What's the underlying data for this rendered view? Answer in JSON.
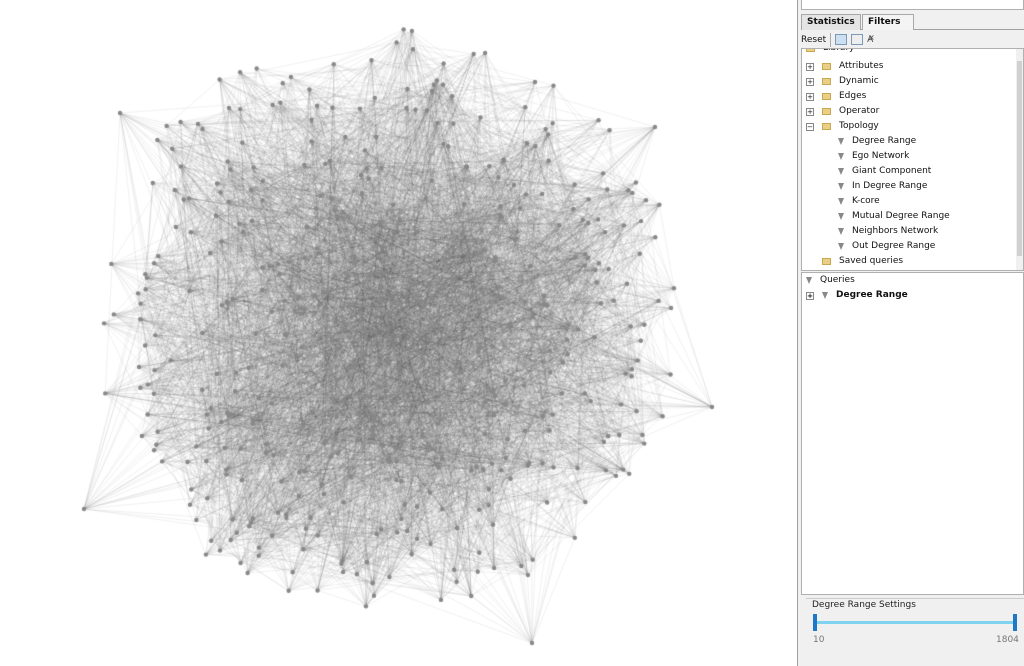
{
  "graph": {
    "node_color": "#888888",
    "edge_color": "#555555"
  },
  "tabs": [
    {
      "label": "Statistics"
    },
    {
      "label": "Filters",
      "close": "×"
    }
  ],
  "toolbar": {
    "reset": "Reset",
    "icons": [
      "filter-panel-icon",
      "select-icon",
      "auto-refresh-icon"
    ],
    "auto_label": "A"
  },
  "tree": {
    "library": "Library",
    "items": [
      {
        "label": "Attributes",
        "type": "folder",
        "expander": "+"
      },
      {
        "label": "Dynamic",
        "type": "folder",
        "expander": "+"
      },
      {
        "label": "Edges",
        "type": "folder",
        "expander": "+"
      },
      {
        "label": "Operator",
        "type": "folder",
        "expander": "+"
      },
      {
        "label": "Topology",
        "type": "folder",
        "expander": "−"
      },
      {
        "label": "Degree Range",
        "type": "filter"
      },
      {
        "label": "Ego Network",
        "type": "filter"
      },
      {
        "label": "Giant Component",
        "type": "filter"
      },
      {
        "label": "In Degree Range",
        "type": "filter"
      },
      {
        "label": "K-core",
        "type": "filter"
      },
      {
        "label": "Mutual Degree Range",
        "type": "filter"
      },
      {
        "label": "Neighbors Network",
        "type": "filter"
      },
      {
        "label": "Out Degree Range",
        "type": "filter"
      },
      {
        "label": "Saved queries",
        "type": "folder"
      }
    ]
  },
  "queries": {
    "title": "Queries",
    "items": [
      {
        "label": "Degree Range",
        "expander": "+"
      }
    ]
  },
  "settings": {
    "title": "Degree Range Settings",
    "min": "10",
    "max": "1804",
    "slider_color": "#7fd3ef",
    "handle_color": "#1d78c8"
  }
}
